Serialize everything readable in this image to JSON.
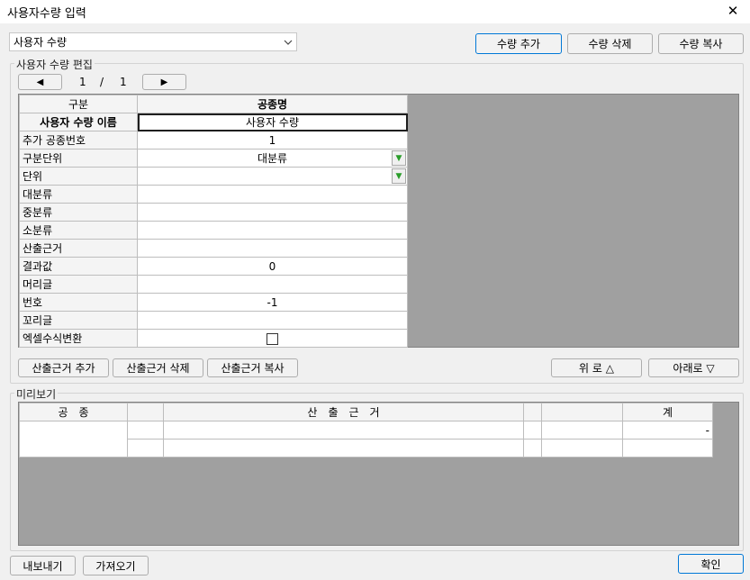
{
  "window": {
    "title": "사용자수량 입력",
    "close_glyph": "✕"
  },
  "top": {
    "qty_select": {
      "value": "사용자 수량",
      "icon": "chevron-down-icon"
    },
    "add_qty": "수량 추가",
    "delete_qty": "수량 삭제",
    "copy_qty": "수량 복사"
  },
  "edit_group": {
    "label": "사용자 수량 편집",
    "pager": {
      "prev": "◀",
      "next": "▶",
      "current": "1",
      "sep": "/",
      "total": "1"
    },
    "header": {
      "col1": "구분",
      "col2": "공종명"
    },
    "rows": [
      {
        "label": "사용자 수량 이름",
        "value": "사용자 수량"
      },
      {
        "label": "추가 공종번호",
        "value": "1"
      },
      {
        "label": "구분단위",
        "value": "대분류"
      },
      {
        "label": "단위",
        "value": ""
      },
      {
        "label": "대분류",
        "value": ""
      },
      {
        "label": "중분류",
        "value": ""
      },
      {
        "label": "소분류",
        "value": ""
      },
      {
        "label": "산출근거",
        "value": ""
      },
      {
        "label": "결과값",
        "value": "0"
      },
      {
        "label": "머리글",
        "value": ""
      },
      {
        "label": "번호",
        "value": "-1"
      },
      {
        "label": "꼬리글",
        "value": ""
      },
      {
        "label": "엑셀수식변환",
        "value": ""
      }
    ],
    "dropdown_glyph": "▼",
    "add_basis": "산출근거 추가",
    "delete_basis": "산출근거 삭제",
    "copy_basis": "산출근거 복사",
    "move_up": "위 로 △",
    "move_down": "아래로 ▽"
  },
  "preview_group": {
    "label": "미리보기",
    "header": {
      "c1": "공　종",
      "c3": "산　출　근　거",
      "c7": "계"
    },
    "row1_total": "-"
  },
  "bottom": {
    "export": "내보내기",
    "import": "가져오기",
    "ok": "확인"
  }
}
